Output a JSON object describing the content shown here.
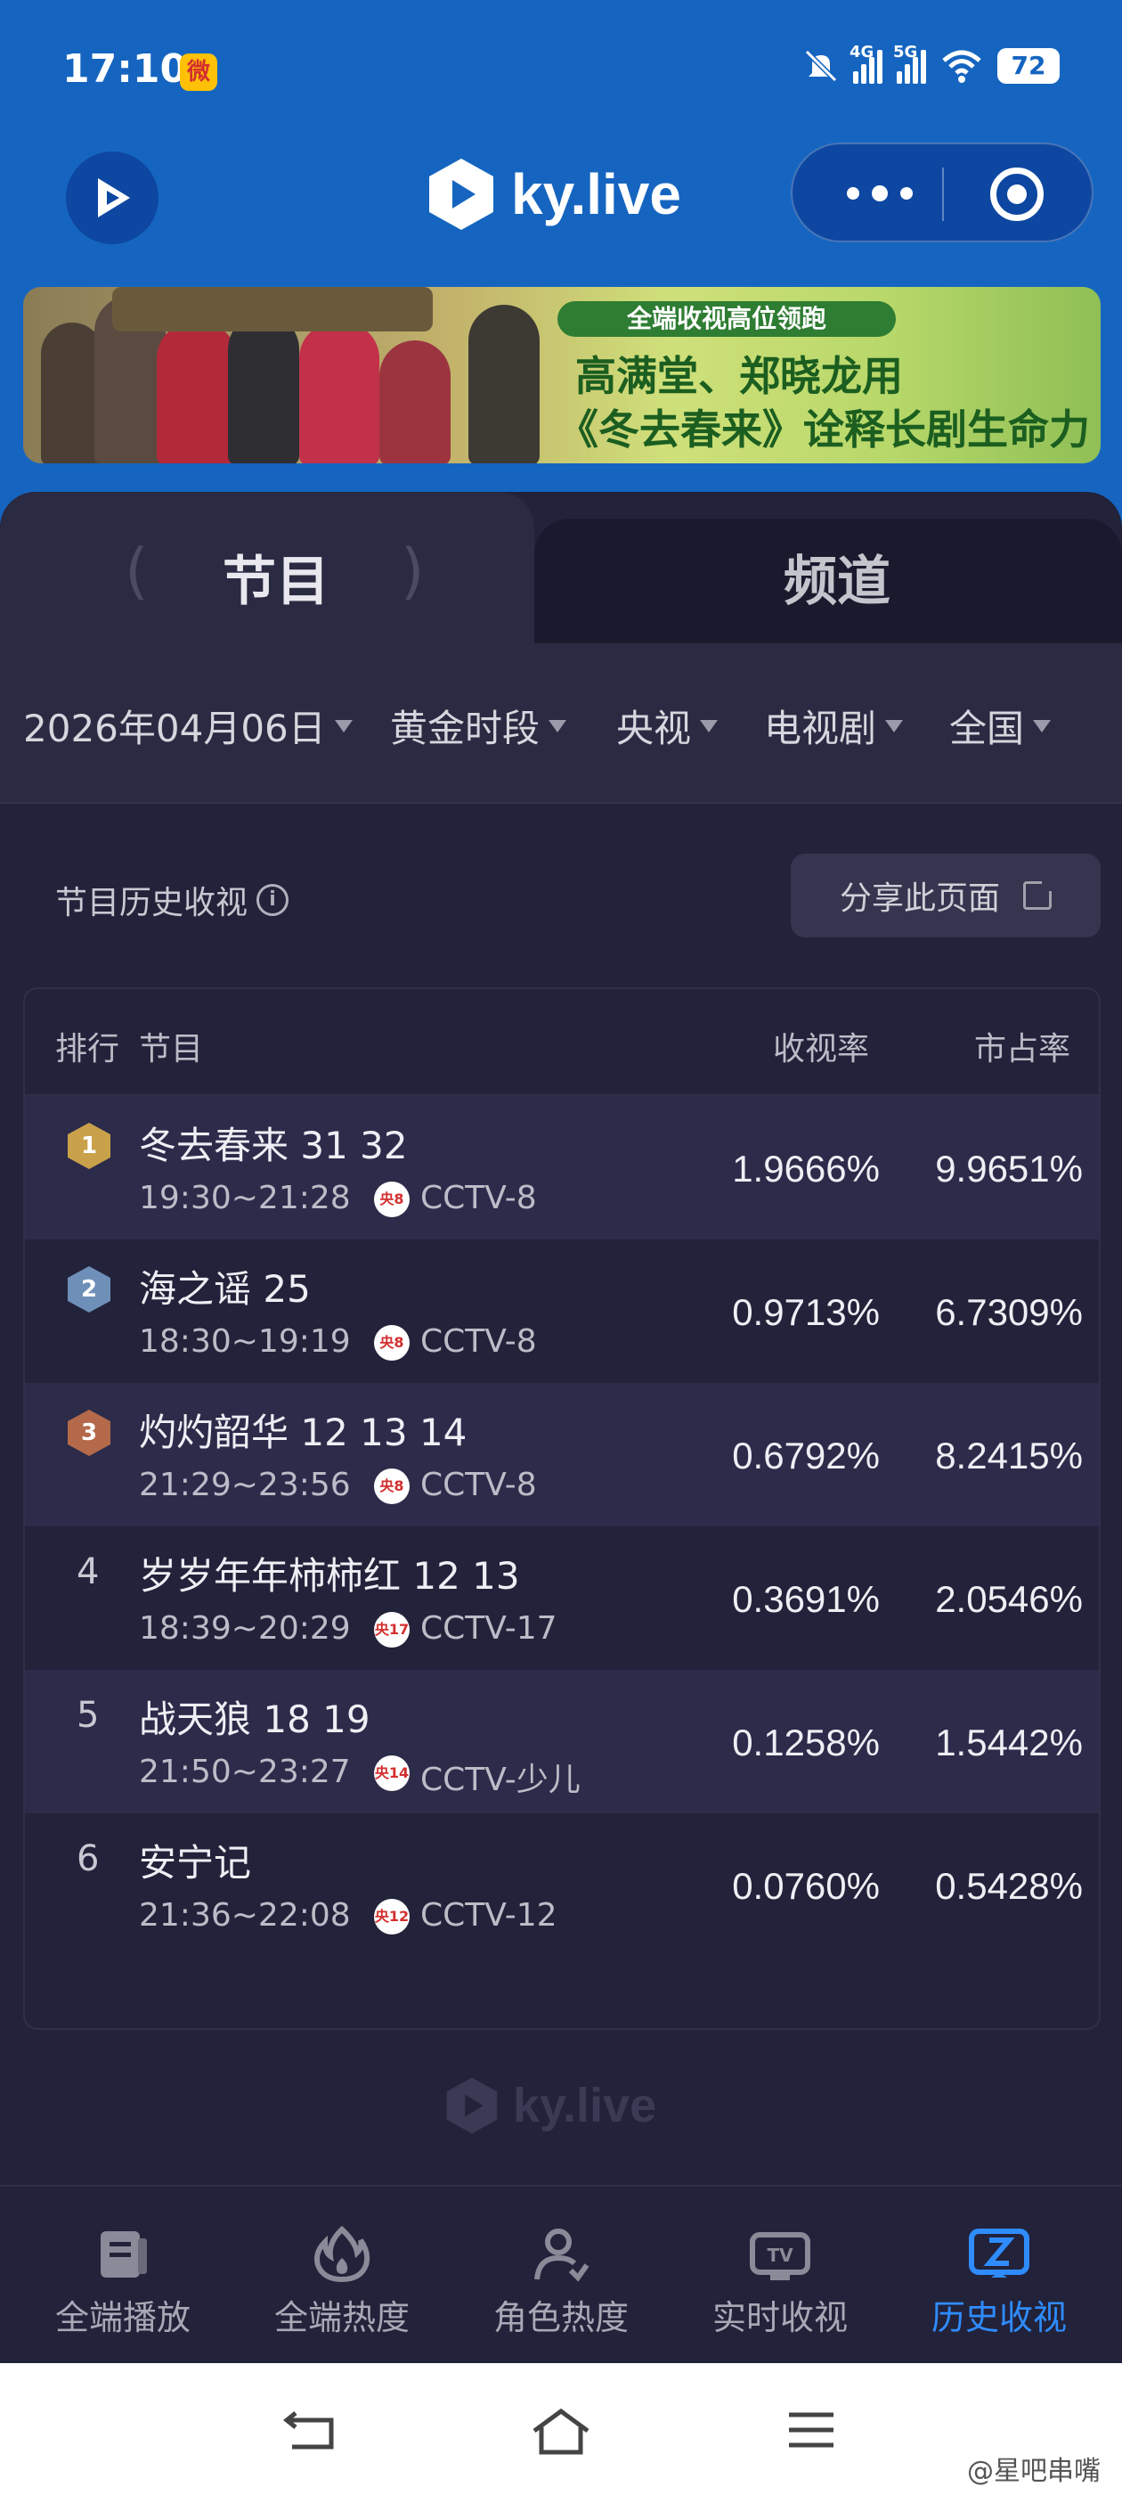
{
  "status_bar": {
    "time": "17:10",
    "net1": "4G",
    "net2": "5G",
    "battery": "72"
  },
  "app": {
    "brand": "ky.live"
  },
  "banner": {
    "tagline": "全端收视高位领跑",
    "line1": "高满堂、郑晓龙用",
    "line2": "《冬去春来》诠释长剧生命力"
  },
  "tabs": [
    {
      "label": "节目"
    },
    {
      "label": "频道"
    }
  ],
  "filters": [
    {
      "label": "2026年04月06日"
    },
    {
      "label": "黄金时段"
    },
    {
      "label": "央视"
    },
    {
      "label": "电视剧"
    },
    {
      "label": "全国"
    }
  ],
  "section": {
    "title": "节目历史收视",
    "share_label": "分享此页面"
  },
  "table": {
    "headers": {
      "rank": "排行",
      "program": "节目",
      "rating": "收视率",
      "share": "市占率"
    },
    "rows": [
      {
        "rank": "1",
        "title": "冬去春来 31 32",
        "time": "19:30~21:28",
        "channel_logo": "央8",
        "channel": "CCTV-8",
        "rating": "1.9666%",
        "share": "9.9651%",
        "badge_color": "#c9a14a"
      },
      {
        "rank": "2",
        "title": "海之谣 25",
        "time": "18:30~19:19",
        "channel_logo": "央8",
        "channel": "CCTV-8",
        "rating": "0.9713%",
        "share": "6.7309%",
        "badge_color": "#6e8fb8"
      },
      {
        "rank": "3",
        "title": "灼灼韶华 12 13 14",
        "time": "21:29~23:56",
        "channel_logo": "央8",
        "channel": "CCTV-8",
        "rating": "0.6792%",
        "share": "8.2415%",
        "badge_color": "#b46a4a"
      },
      {
        "rank": "4",
        "title": "岁岁年年柿柿红 12 13",
        "time": "18:39~20:29",
        "channel_logo": "央17",
        "channel": "CCTV-17",
        "rating": "0.3691%",
        "share": "2.0546%"
      },
      {
        "rank": "5",
        "title": "战天狼 18 19",
        "time": "21:50~23:27",
        "channel_logo": "央14",
        "channel": "CCTV-少儿",
        "rating": "0.1258%",
        "share": "1.5442%"
      },
      {
        "rank": "6",
        "title": "安宁记",
        "time": "21:36~22:08",
        "channel_logo": "央12",
        "channel": "CCTV-12",
        "rating": "0.0760%",
        "share": "0.5428%"
      }
    ]
  },
  "watermark": "ky.live",
  "bottom_nav": [
    {
      "label": "全端播放",
      "icon": "book-icon"
    },
    {
      "label": "全端热度",
      "icon": "flame-icon"
    },
    {
      "label": "角色热度",
      "icon": "person-icon"
    },
    {
      "label": "实时收视",
      "icon": "tv-icon"
    },
    {
      "label": "历史收视",
      "icon": "history-icon",
      "active": true
    }
  ],
  "footer_tag": "@星吧串嘴",
  "colors": {
    "accent": "#2f8cff",
    "header_blue": "#1565c0",
    "bg_dark": "#22223a"
  }
}
